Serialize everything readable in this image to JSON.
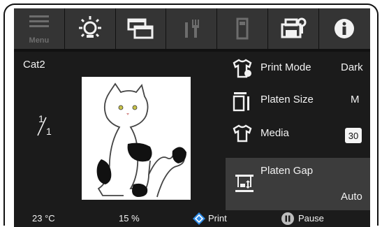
{
  "toolbar": {
    "menu_label": "Menu",
    "buttons": [
      {
        "icon": "menu-icon",
        "label": "Menu"
      },
      {
        "icon": "brightness-icon"
      },
      {
        "icon": "windows-icon"
      },
      {
        "icon": "tools-icon"
      },
      {
        "icon": "cartridge-icon"
      },
      {
        "icon": "printer-settings-icon"
      },
      {
        "icon": "info-icon"
      }
    ]
  },
  "job": {
    "name": "Cat2",
    "fraction_top": "1",
    "fraction_bottom": "1"
  },
  "settings": {
    "print_mode": {
      "label": "Print Mode",
      "value": "Dark"
    },
    "platen_size": {
      "label": "Platen Size",
      "value": "M"
    },
    "media": {
      "label": "Media",
      "value": "30"
    },
    "platen_gap": {
      "label": "Platen Gap",
      "value": "Auto"
    }
  },
  "status": {
    "temperature": "23 °C",
    "percent": "15 %",
    "print_label": "Print",
    "pause_label": "Pause"
  },
  "colors": {
    "screen_bg": "#1b1b1b",
    "button_bg": "#343434",
    "print_blue": "#2f8ce8"
  }
}
